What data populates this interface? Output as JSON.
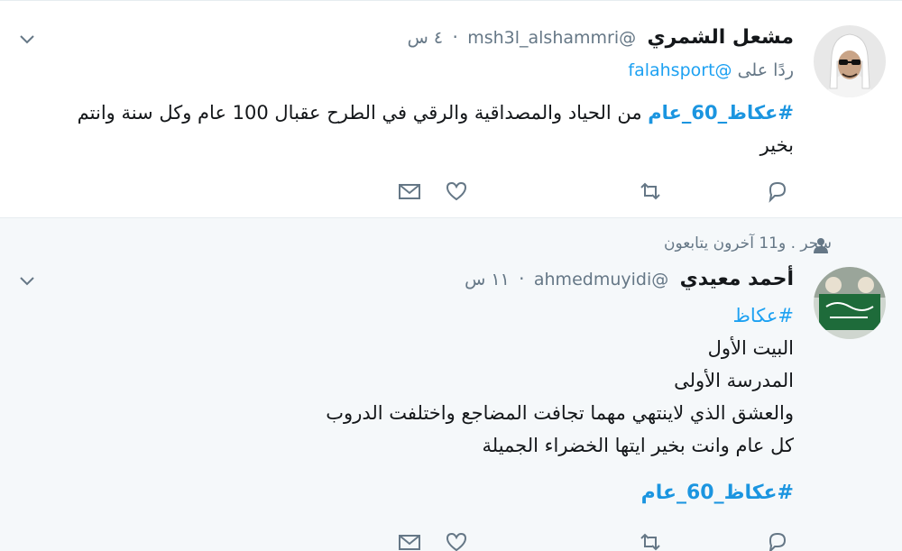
{
  "tweets": [
    {
      "name": "مشعل الشمري",
      "handle": "@msh3l_alshammri",
      "dot": "·",
      "time": "٤ س",
      "reply_prefix": "ردًا على",
      "reply_to": "@falahsport",
      "hashtag": "#عكاظ_60_عام",
      "text_rest": " من الحياد والمصداقية والرقي في الطرح عقبال 100 عام وكل سنة وانتم بخير"
    },
    {
      "social_context": "سحر . و11 آخرون يتابعون",
      "name": "أحمد معيدي",
      "handle": "@ahmedmuyidi",
      "dot": "·",
      "time": "١١ س",
      "lines": [
        "#عكاظ",
        "البيت الأول",
        "المدرسة الأولى",
        "والعشق الذي لاينتهي مهما تجافت المضاجع واختلفت الدروب",
        "كل عام وانت بخير ايتها الخضراء الجميلة"
      ],
      "hashtag_bottom": "#عكاظ_60_عام"
    }
  ],
  "icons": {
    "caret": "chevron-down-icon",
    "reply": "reply-icon",
    "retweet": "retweet-icon",
    "like": "heart-icon",
    "dm": "envelope-icon",
    "person": "person-icon"
  },
  "colors": {
    "link": "#1da1f2",
    "muted": "#657786",
    "highlight_bg": "#f5f8fa"
  }
}
